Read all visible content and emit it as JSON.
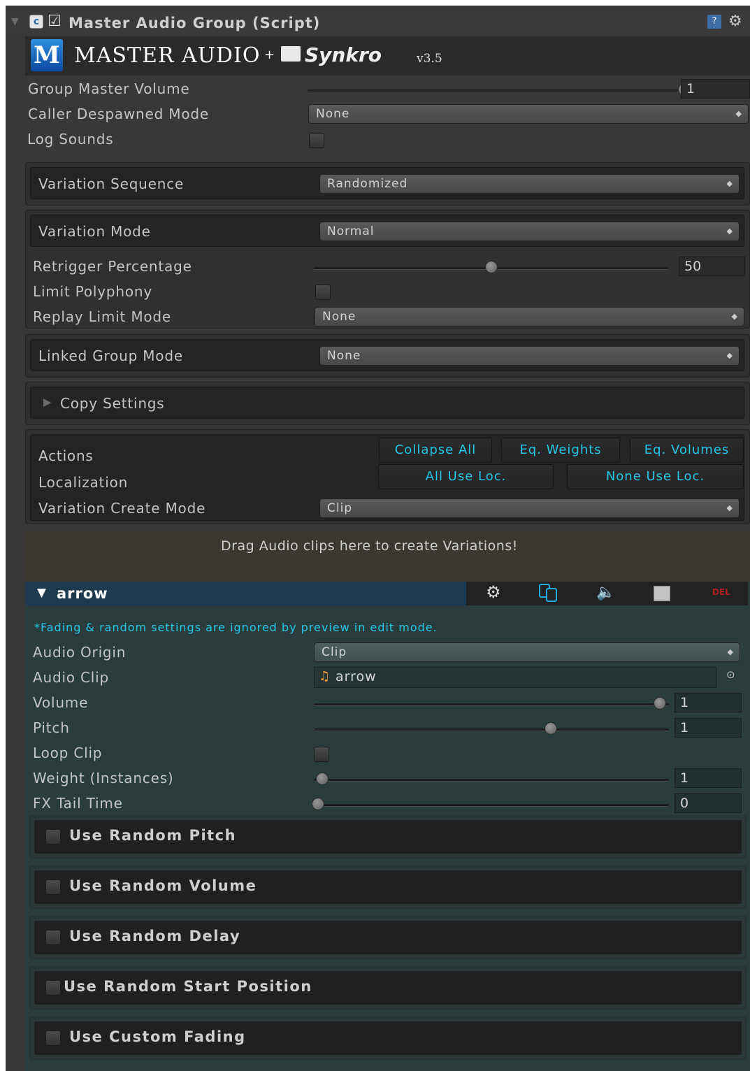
{
  "header": {
    "title": "Master Audio Group (Script)",
    "logo_text": "MASTER AUDIO",
    "plus": "+",
    "partner": "Synkro",
    "version": "v3.5"
  },
  "group": {
    "master_volume_label": "Group Master Volume",
    "master_volume_value": "1",
    "master_volume_fraction": 1.0,
    "despawn_label": "Caller Despawned Mode",
    "despawn_value": "None",
    "log_label": "Log Sounds"
  },
  "sequence": {
    "label": "Variation Sequence",
    "value": "Randomized"
  },
  "mode": {
    "label": "Variation Mode",
    "value": "Normal",
    "retrigger_label": "Retrigger Percentage",
    "retrigger_value": "50",
    "retrigger_fraction": 0.5,
    "polyphony_label": "Limit Polyphony",
    "replay_label": "Replay Limit Mode",
    "replay_value": "None"
  },
  "linked": {
    "label": "Linked Group Mode",
    "value": "None"
  },
  "copy": {
    "label": "Copy Settings"
  },
  "actions": {
    "label": "Actions",
    "collapse": "Collapse All",
    "eq_weights": "Eq. Weights",
    "eq_volumes": "Eq. Volumes",
    "localization_label": "Localization",
    "all_use": "All Use Loc.",
    "none_use": "None Use Loc.",
    "create_label": "Variation Create Mode",
    "create_value": "Clip"
  },
  "drop_zone": "Drag Audio clips here to create Variations!",
  "variation": {
    "name": "arrow",
    "del": "DEL",
    "note": "*Fading & random settings are ignored by preview in edit mode.",
    "origin_label": "Audio Origin",
    "origin_value": "Clip",
    "clip_label": "Audio Clip",
    "clip_value": "arrow",
    "volume_label": "Volume",
    "volume_value": "1",
    "volume_fraction": 1.0,
    "pitch_label": "Pitch",
    "pitch_value": "1",
    "pitch_fraction": 0.67,
    "loop_label": "Loop Clip",
    "weight_label": "Weight (Instances)",
    "weight_value": "1",
    "weight_fraction": 0.0,
    "tail_label": "FX Tail Time",
    "tail_value": "0",
    "tail_fraction": 0.0
  },
  "options": {
    "random_pitch": "Use Random Pitch",
    "random_volume": "Use Random Volume",
    "random_delay": "Use Random Delay",
    "random_start": "Use Random Start Position",
    "custom_fading": "Use Custom Fading"
  },
  "colors": {
    "accent": "#25c7e8",
    "panel_teal": "#2b3c3c",
    "header_blue": "#1d3a4e"
  }
}
